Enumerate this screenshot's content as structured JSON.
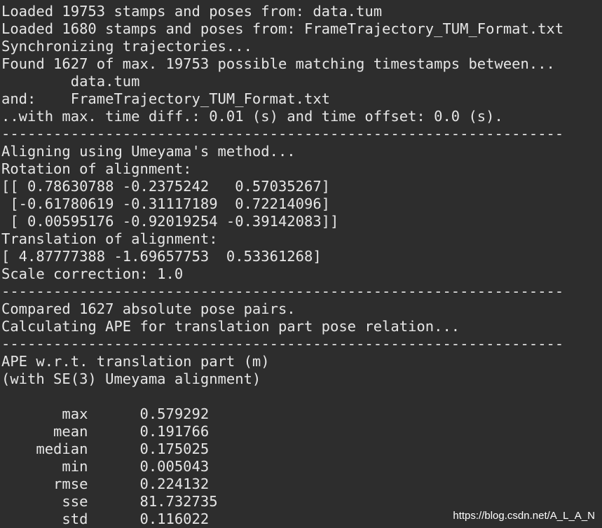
{
  "terminal": {
    "lines": [
      "Loaded 19753 stamps and poses from: data.tum",
      "Loaded 1680 stamps and poses from: FrameTrajectory_TUM_Format.txt",
      "Synchronizing trajectories...",
      "Found 1627 of max. 19753 possible matching timestamps between...",
      "        data.tum",
      "and:    FrameTrajectory_TUM_Format.txt",
      "..with max. time diff.: 0.01 (s) and time offset: 0.0 (s).",
      "-----------------------------------------------------------------",
      "Aligning using Umeyama's method...",
      "Rotation of alignment:",
      "[[ 0.78630788 -0.2375242   0.57035267]",
      " [-0.61780619 -0.31117189  0.72214096]",
      " [ 0.00595176 -0.92019254 -0.39142083]]",
      "Translation of alignment:",
      "[ 4.87777388 -1.69657753  0.53361268]",
      "Scale correction: 1.0",
      "-----------------------------------------------------------------",
      "Compared 1627 absolute pose pairs.",
      "Calculating APE for translation part pose relation...",
      "-----------------------------------------------------------------",
      "APE w.r.t. translation part (m)",
      "(with SE(3) Umeyama alignment)",
      "",
      "       max      0.579292",
      "      mean      0.191766",
      "    median      0.175025",
      "       min      0.005043",
      "      rmse      0.224132",
      "       sse      81.732735",
      "       std      0.116022"
    ]
  },
  "watermark": "https://blog.csdn.net/A_L_A_N"
}
